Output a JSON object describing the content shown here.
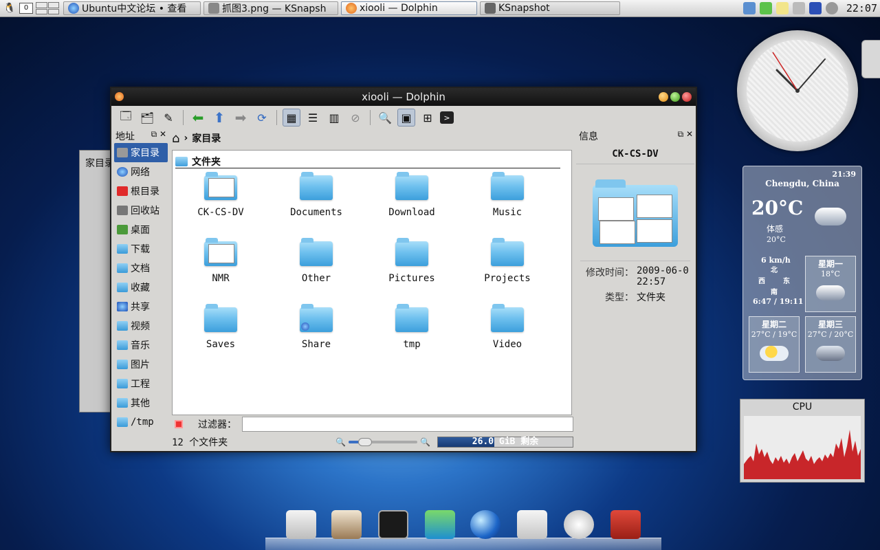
{
  "taskbar": {
    "desktop_num": "0",
    "tasks": [
      {
        "label": "Ubuntu中文论坛 • 查看",
        "icon": "globe-icon"
      },
      {
        "label": "抓图3.png — KSnapsh",
        "icon": "image-icon"
      },
      {
        "label": "xiooli — Dolphin",
        "icon": "dolphin-icon"
      },
      {
        "label": "KSnapshot",
        "icon": "camera-icon"
      }
    ],
    "clock": "22:07"
  },
  "bg_window": {
    "title": "家目录"
  },
  "window": {
    "title": "xiooli — Dolphin",
    "toolbar": [
      "new-window-icon",
      "new-tab-icon",
      "rename-icon",
      "back-icon",
      "up-icon",
      "forward-icon",
      "reload-icon",
      "icons-view-icon",
      "details-view-icon",
      "columns-view-icon",
      "preview-icon",
      "find-icon",
      "split-icon",
      "new-folder-icon",
      "terminal-icon"
    ],
    "places": {
      "header": "地址",
      "items": [
        "家目录",
        "网络",
        "根目录",
        "回收站",
        "桌面",
        "下载",
        "文档",
        "收藏",
        "共享",
        "视频",
        "音乐",
        "图片",
        "工程",
        "其他",
        "/tmp"
      ]
    },
    "breadcrumb": {
      "current": "家目录"
    },
    "group": {
      "title": "文件夹"
    },
    "files": [
      "CK-CS-DV",
      "Documents",
      "Download",
      "Music",
      "NMR",
      "Other",
      "Pictures",
      "Projects",
      "Saves",
      "Share",
      "tmp",
      "Video"
    ],
    "filter": {
      "label": "过滤器：",
      "value": ""
    },
    "status": {
      "count": "12 个文件夹",
      "free": "26.0 GiB 剩余",
      "zoom_fraction": 0.2,
      "used_fraction": 0.42
    },
    "info": {
      "header": "信息",
      "name": "CK-CS-DV",
      "modified_key": "修改时间：",
      "modified_val": "2009-06-0 22:57",
      "type_key": "类型：",
      "type_val": "文件夹"
    }
  },
  "weather": {
    "time": "21:39",
    "city": "Chengdu, China",
    "temp": "20°C",
    "feel_label": "体感",
    "feel": "20°C",
    "wind": "6 km/h",
    "dirs": {
      "n": "北",
      "s": "南",
      "w": "西",
      "e": "东"
    },
    "sun": "6:47 / 19:11",
    "days": [
      {
        "day": "星期一",
        "temp": "18°C"
      },
      {
        "day": "星期二",
        "temp": "27°C / 19°C"
      },
      {
        "day": "星期三",
        "temp": "27°C / 20°C"
      }
    ]
  },
  "cpu": {
    "title": "CPU"
  }
}
